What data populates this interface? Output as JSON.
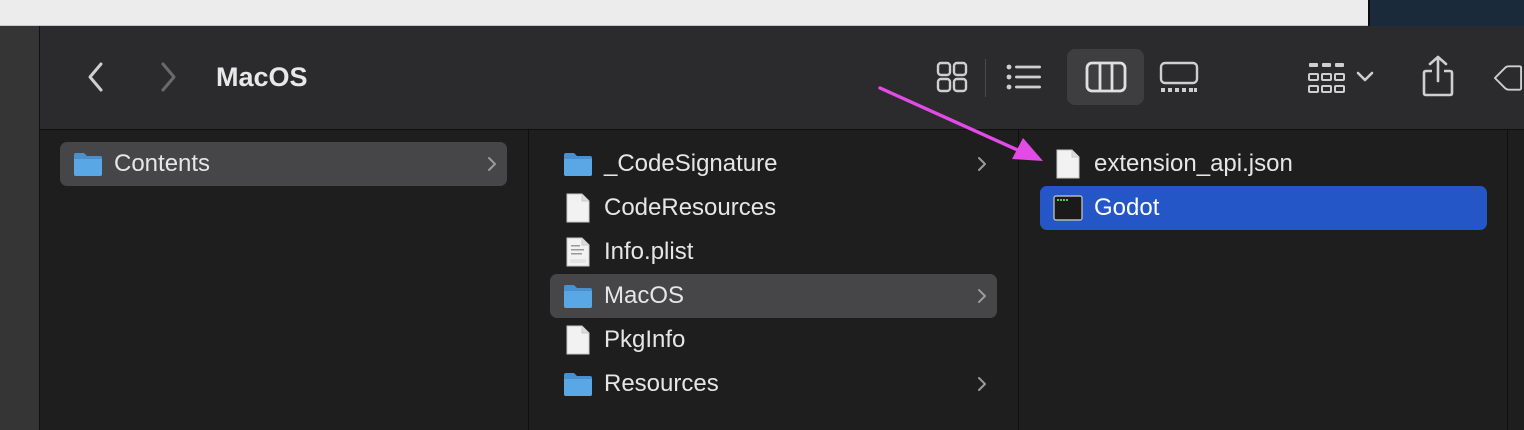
{
  "window": {
    "title": "MacOS"
  },
  "colors": {
    "selection_blue": "#2556c8",
    "selection_gray": "#464648",
    "folder_blue": "#5aa7e6",
    "annotation_arrow": "#e34be6"
  },
  "toolbar": {
    "back_icon": "chevron-left-icon",
    "forward_icon": "chevron-right-icon",
    "views": [
      "icon-view-icon",
      "list-view-icon",
      "column-view-icon",
      "gallery-view-icon"
    ],
    "active_view": "column-view-icon",
    "group_icon": "group-by-icon",
    "share_icon": "share-icon",
    "tag_icon": "tag-icon"
  },
  "columns": [
    {
      "items": [
        {
          "name": "Contents",
          "type": "folder",
          "selected": "gray",
          "has_children": true
        }
      ]
    },
    {
      "items": [
        {
          "name": "_CodeSignature",
          "type": "folder",
          "has_children": true
        },
        {
          "name": "CodeResources",
          "type": "document"
        },
        {
          "name": "Info.plist",
          "type": "plist"
        },
        {
          "name": "MacOS",
          "type": "folder",
          "selected": "gray",
          "has_children": true
        },
        {
          "name": "PkgInfo",
          "type": "document"
        },
        {
          "name": "Resources",
          "type": "folder",
          "has_children": true
        }
      ]
    },
    {
      "items": [
        {
          "name": "extension_api.json",
          "type": "document"
        },
        {
          "name": "Godot",
          "type": "executable",
          "selected": "blue"
        }
      ]
    }
  ]
}
